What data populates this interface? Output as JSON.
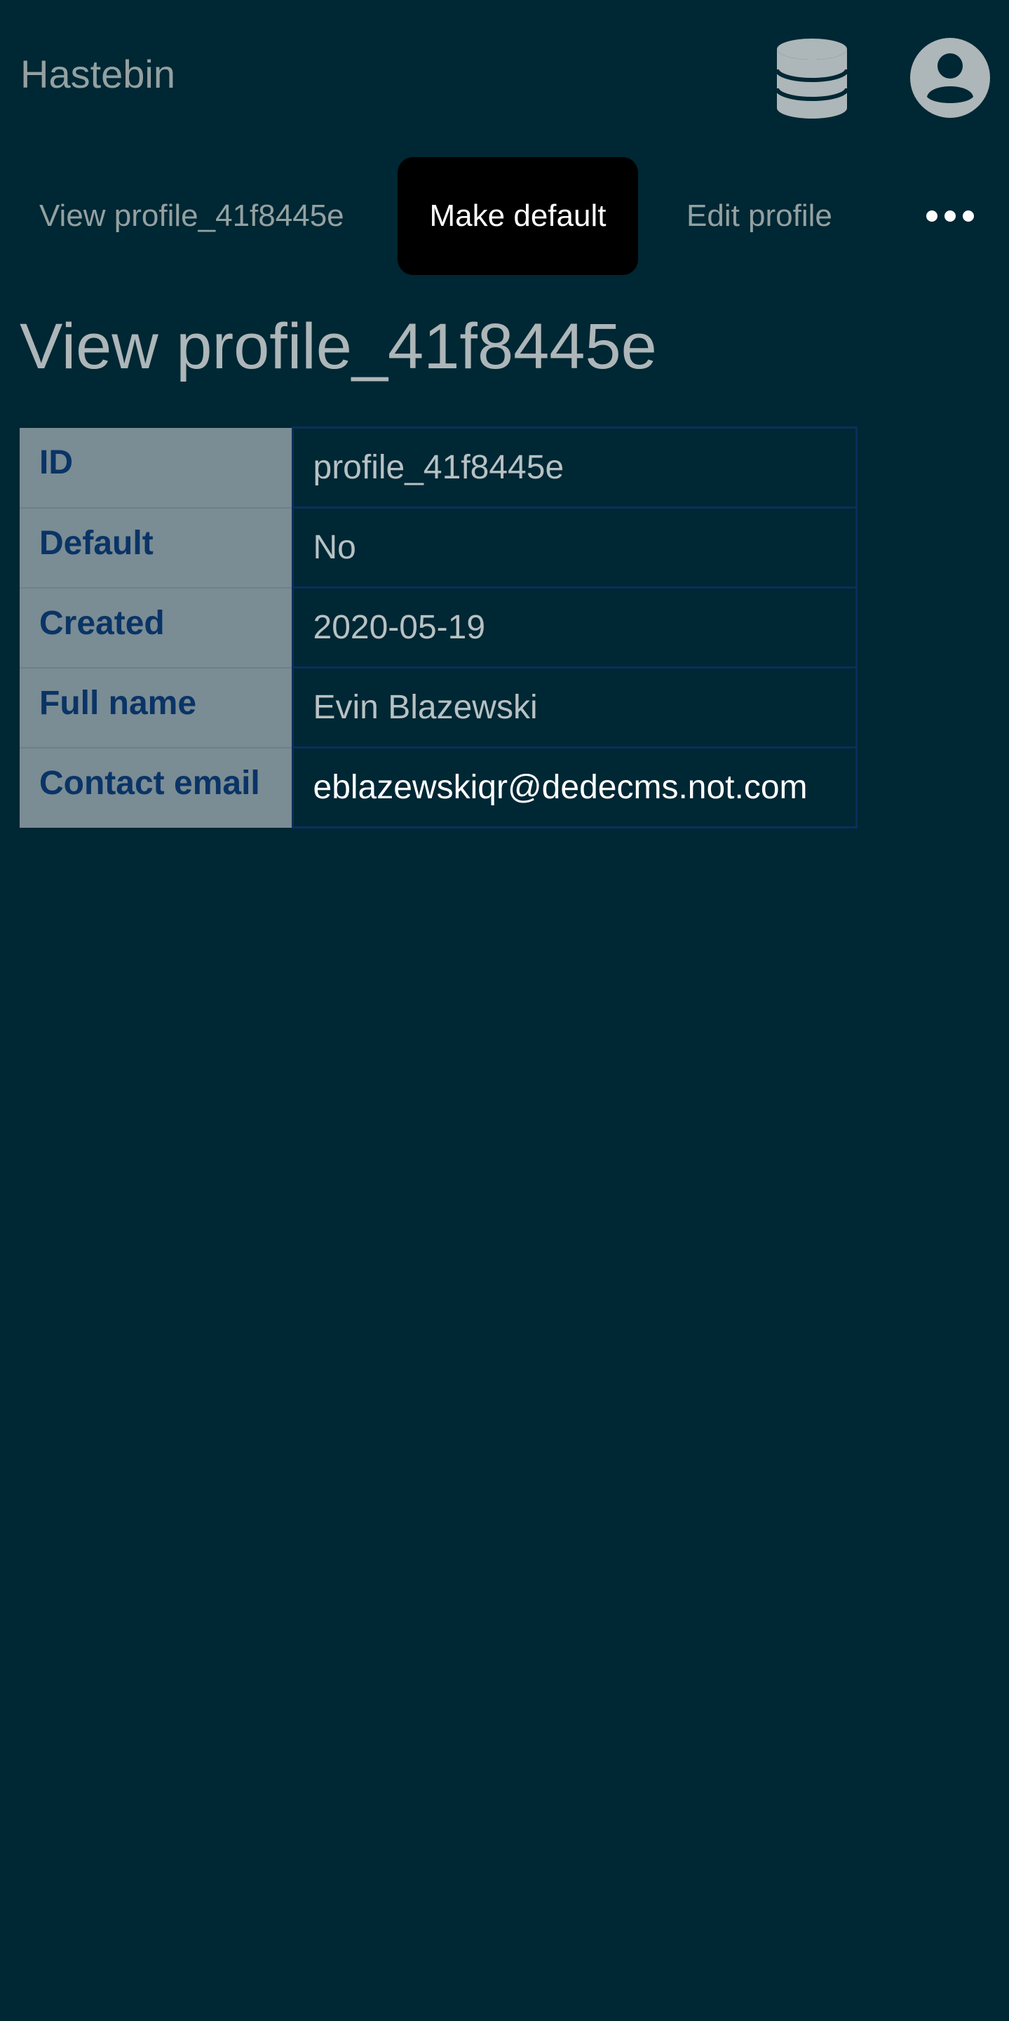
{
  "header": {
    "app_title": "Hastebin",
    "icons": [
      "database-icon",
      "user-circle-icon"
    ]
  },
  "nav": {
    "view_label": "View profile_41f8445e",
    "make_default_label": "Make default",
    "edit_label": "Edit profile",
    "more_icon": "ellipsis-icon"
  },
  "page": {
    "title": "View profile_41f8445e"
  },
  "details": {
    "rows": [
      {
        "label": "ID",
        "value": "profile_41f8445e"
      },
      {
        "label": "Default",
        "value": "No"
      },
      {
        "label": "Created",
        "value": "2020-05-19"
      },
      {
        "label": "Full name",
        "value": "Evin Blazewski"
      },
      {
        "label": "Contact email",
        "value": "eblazewskiqr@dedecms.not.com"
      }
    ]
  },
  "colors": {
    "background": "#002734",
    "button_bg": "#000000",
    "table_header_bg": "#7a8c94",
    "table_header_text": "#0a3466",
    "table_border": "#0b2f5b"
  }
}
